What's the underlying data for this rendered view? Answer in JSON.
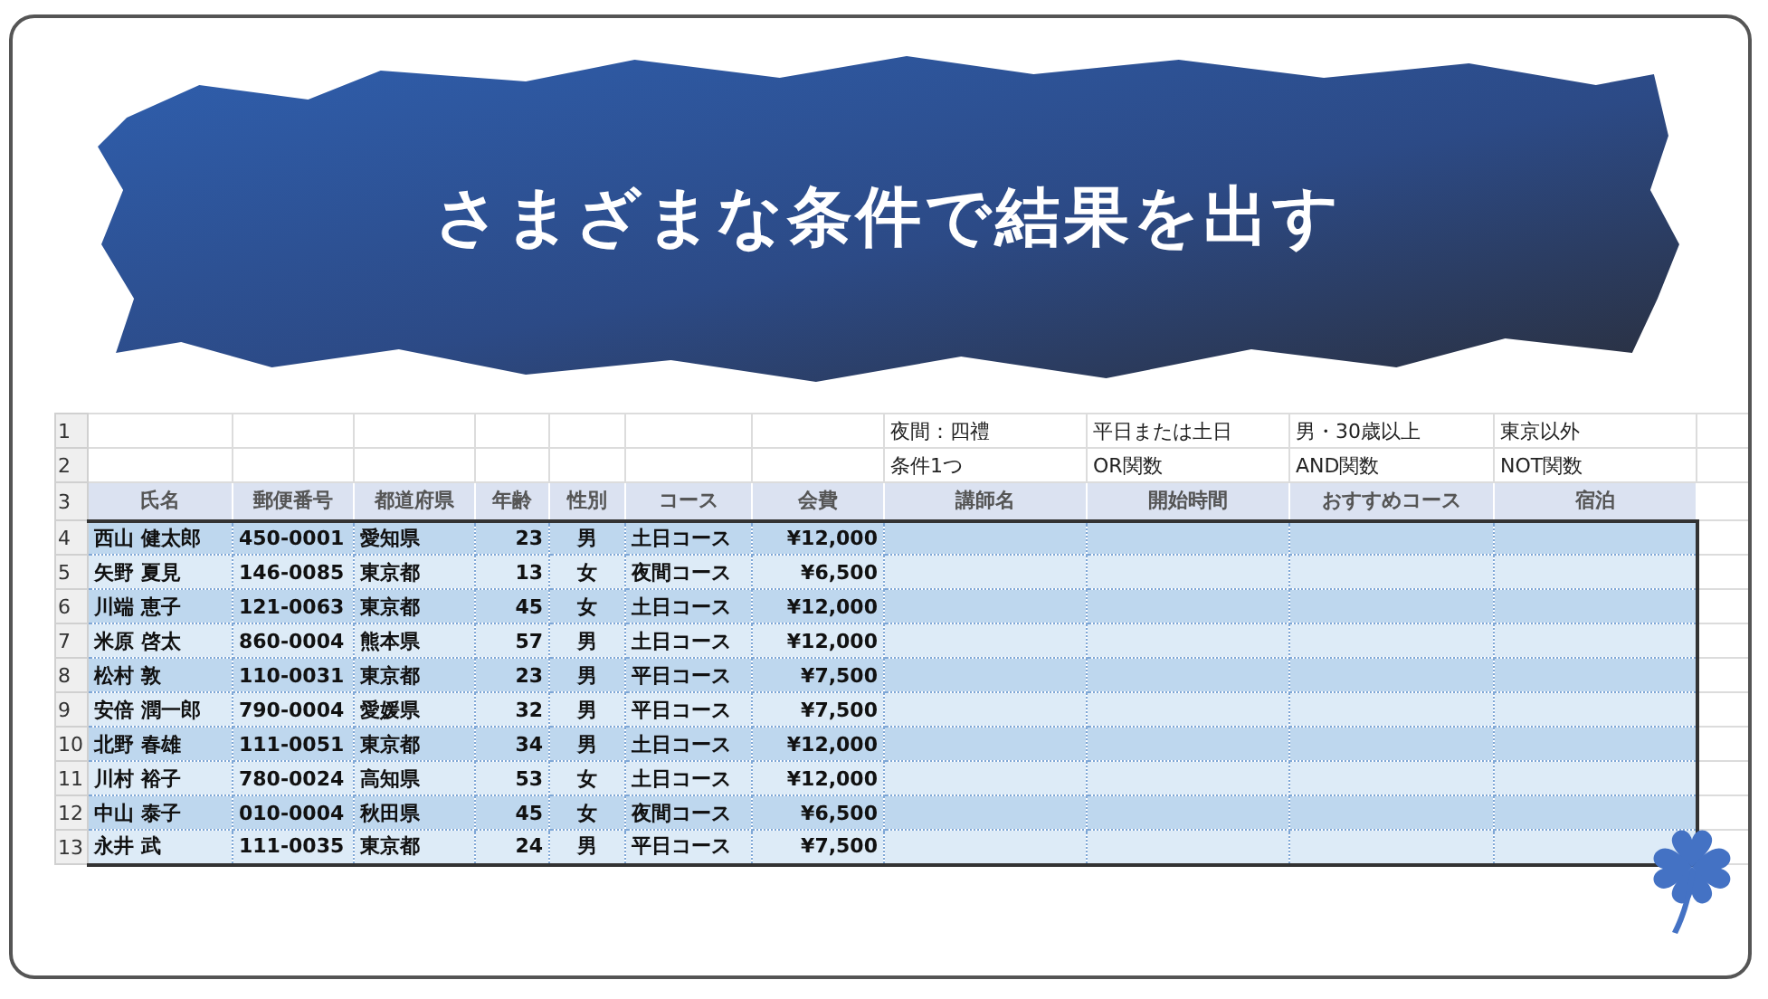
{
  "banner": {
    "title": "さまざまな条件で結果を出す"
  },
  "sheet": {
    "condition_rows": [
      {
        "number": "1",
        "cells": [
          "",
          "",
          "",
          "",
          "",
          "",
          "",
          "夜間：四禮",
          "平日または土日",
          "男・30歳以上",
          "東京以外"
        ]
      },
      {
        "number": "2",
        "cells": [
          "",
          "",
          "",
          "",
          "",
          "",
          "",
          "条件1つ",
          "OR関数",
          "AND関数",
          "NOT関数"
        ]
      }
    ],
    "header_row": {
      "number": "3",
      "columns": [
        "氏名",
        "郵便番号",
        "都道府県",
        "年齢",
        "性別",
        "コース",
        "会費",
        "講師名",
        "開始時間",
        "おすすめコース",
        "宿泊"
      ]
    },
    "rows": [
      {
        "number": "4",
        "cells": [
          "西山 健太郎",
          "450-0001",
          "愛知県",
          "23",
          "男",
          "土日コース",
          "¥12,000"
        ]
      },
      {
        "number": "5",
        "cells": [
          "矢野 夏見",
          "146-0085",
          "東京都",
          "13",
          "女",
          "夜間コース",
          "¥6,500"
        ]
      },
      {
        "number": "6",
        "cells": [
          "川端 恵子",
          "121-0063",
          "東京都",
          "45",
          "女",
          "土日コース",
          "¥12,000"
        ]
      },
      {
        "number": "7",
        "cells": [
          "米原 啓太",
          "860-0004",
          "熊本県",
          "57",
          "男",
          "土日コース",
          "¥12,000"
        ]
      },
      {
        "number": "8",
        "cells": [
          "松村 敦",
          "110-0031",
          "東京都",
          "23",
          "男",
          "平日コース",
          "¥7,500"
        ]
      },
      {
        "number": "9",
        "cells": [
          "安倍 潤一郎",
          "790-0004",
          "愛媛県",
          "32",
          "男",
          "平日コース",
          "¥7,500"
        ]
      },
      {
        "number": "10",
        "cells": [
          "北野 春雄",
          "111-0051",
          "東京都",
          "34",
          "男",
          "土日コース",
          "¥12,000"
        ]
      },
      {
        "number": "11",
        "cells": [
          "川村 裕子",
          "780-0024",
          "高知県",
          "53",
          "女",
          "土日コース",
          "¥12,000"
        ]
      },
      {
        "number": "12",
        "cells": [
          "中山 泰子",
          "010-0004",
          "秋田県",
          "45",
          "女",
          "夜間コース",
          "¥6,500"
        ]
      },
      {
        "number": "13",
        "cells": [
          "永井 武",
          "111-0035",
          "東京都",
          "24",
          "男",
          "平日コース",
          "¥7,500"
        ]
      }
    ]
  }
}
